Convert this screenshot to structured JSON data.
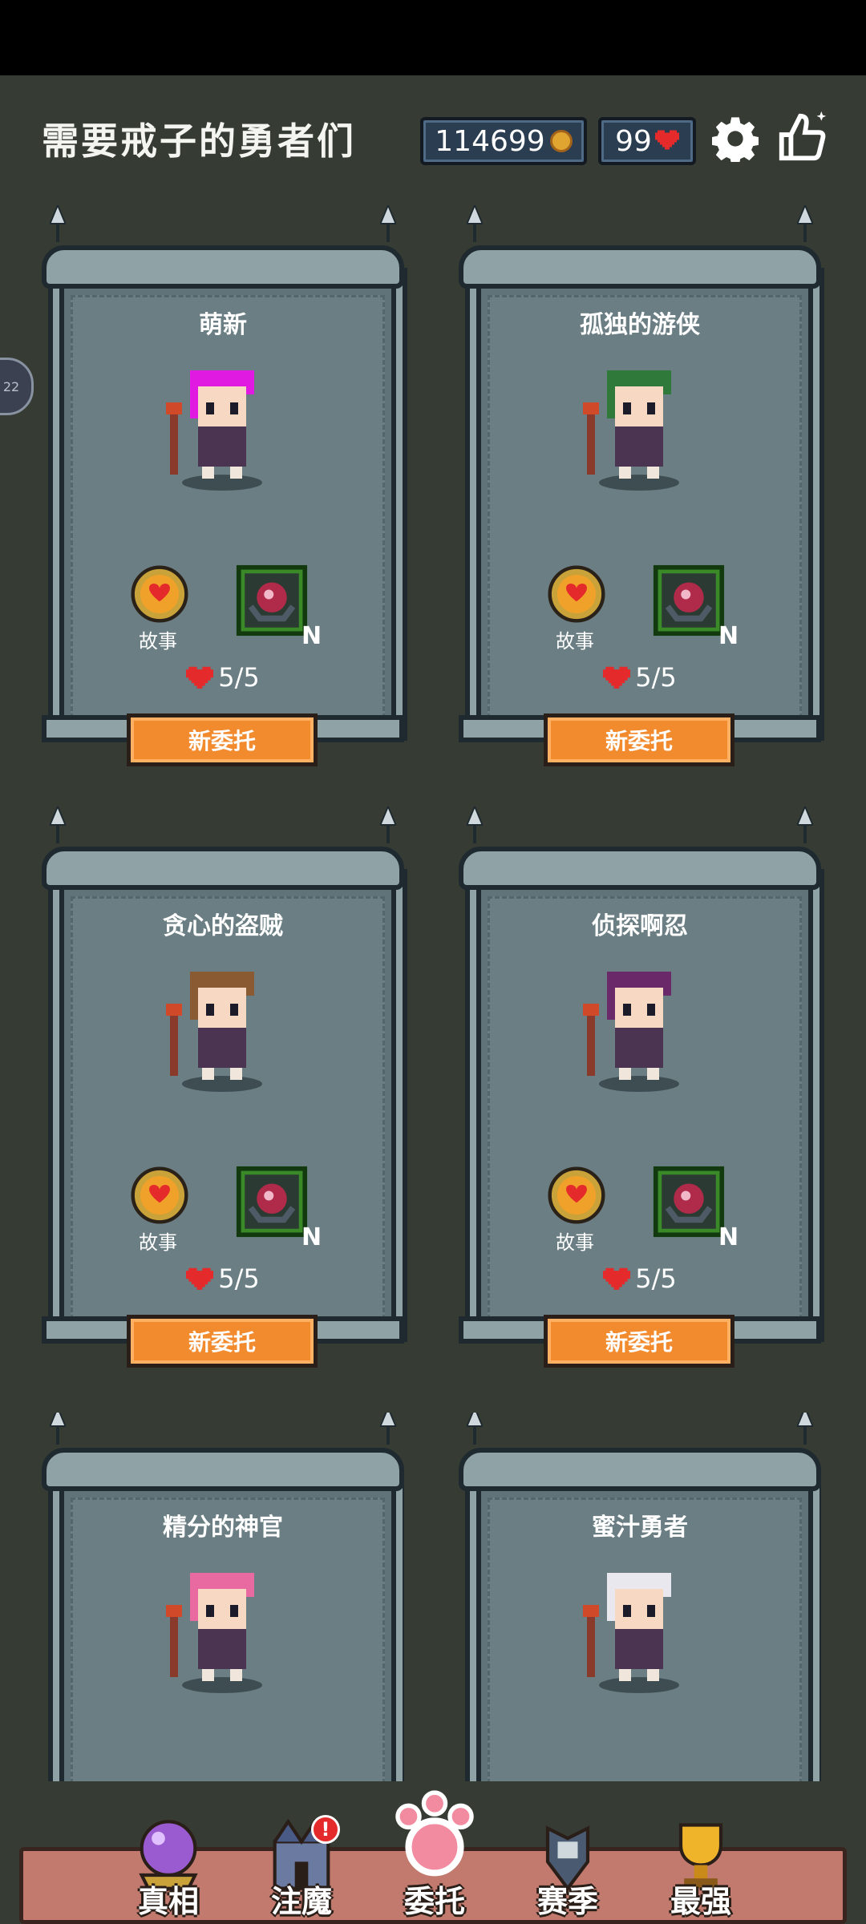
{
  "header": {
    "title": "需要戒子的勇者们",
    "gold": "114699",
    "lives": "99"
  },
  "side_tab": "22",
  "heroes": [
    {
      "name": "萌新",
      "story_label": "故事",
      "relic_rank": "N",
      "lives": "5/5",
      "button": "新委托"
    },
    {
      "name": "孤独的游侠",
      "story_label": "故事",
      "relic_rank": "N",
      "lives": "5/5",
      "button": "新委托"
    },
    {
      "name": "贪心的盗贼",
      "story_label": "故事",
      "relic_rank": "N",
      "lives": "5/5",
      "button": "新委托"
    },
    {
      "name": "侦探啊忍",
      "story_label": "故事",
      "relic_rank": "N",
      "lives": "5/5",
      "button": "新委托"
    },
    {
      "name": "精分的神官"
    },
    {
      "name": "蜜汁勇者"
    }
  ],
  "tabs": [
    {
      "label": "真相",
      "icon": "crystal-ball-icon"
    },
    {
      "label": "注魔",
      "icon": "castle-icon",
      "badge": "!"
    },
    {
      "label": "委托",
      "icon": "paw-icon",
      "active": true
    },
    {
      "label": "赛季",
      "icon": "armor-icon"
    },
    {
      "label": "最强",
      "icon": "trophy-icon"
    }
  ],
  "colors": {
    "accent": "#f28a2e",
    "panel": "#5f7378",
    "background": "#363b33",
    "bar": "#c27a6e"
  }
}
